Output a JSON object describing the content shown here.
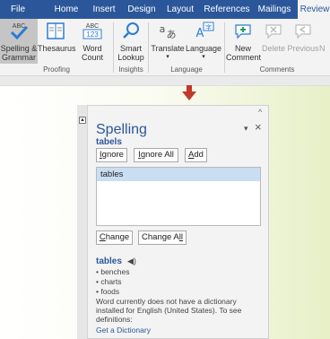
{
  "ribbon": {
    "tabs": [
      "File",
      "Home",
      "Insert",
      "Design",
      "Layout",
      "References",
      "Mailings",
      "Review"
    ],
    "active_tab": "Review",
    "buttons": {
      "spelling": [
        "Spelling &",
        "Grammar"
      ],
      "thesaurus": "Thesaurus",
      "word_count": [
        "Word",
        "Count"
      ],
      "smart_lookup": [
        "Smart",
        "Lookup"
      ],
      "translate": "Translate",
      "language": "Language",
      "new_comment": [
        "New",
        "Comment"
      ],
      "delete": "Delete",
      "previous": "Previous",
      "next": "N"
    },
    "word_count_icon": "ABC 123",
    "groups": [
      "Proofing",
      "Insights",
      "Language",
      "Comments"
    ]
  },
  "pane": {
    "title": "Spelling",
    "word": "tabels",
    "buttons": {
      "ignore": [
        "I",
        "gnore"
      ],
      "ignore_all": [
        "I",
        "gnore All"
      ],
      "add": [
        "A",
        "dd"
      ],
      "change": [
        "C",
        "hange"
      ],
      "change_all": [
        "Change A",
        "ll"
      ]
    },
    "suggestions": [
      "tables"
    ],
    "definition": {
      "word": "tables",
      "synonyms": [
        "• benches",
        "• charts",
        "• foods"
      ],
      "note": "Word currently does not have a dictionary installed for English (United States). To see definitions:",
      "link": "Get a Dictionary"
    }
  },
  "colors": {
    "ribbon_tab_bar": "#2b579a",
    "accent": "#2b579a",
    "arrow": "#c0392b",
    "selection": "#c9ddf3"
  }
}
